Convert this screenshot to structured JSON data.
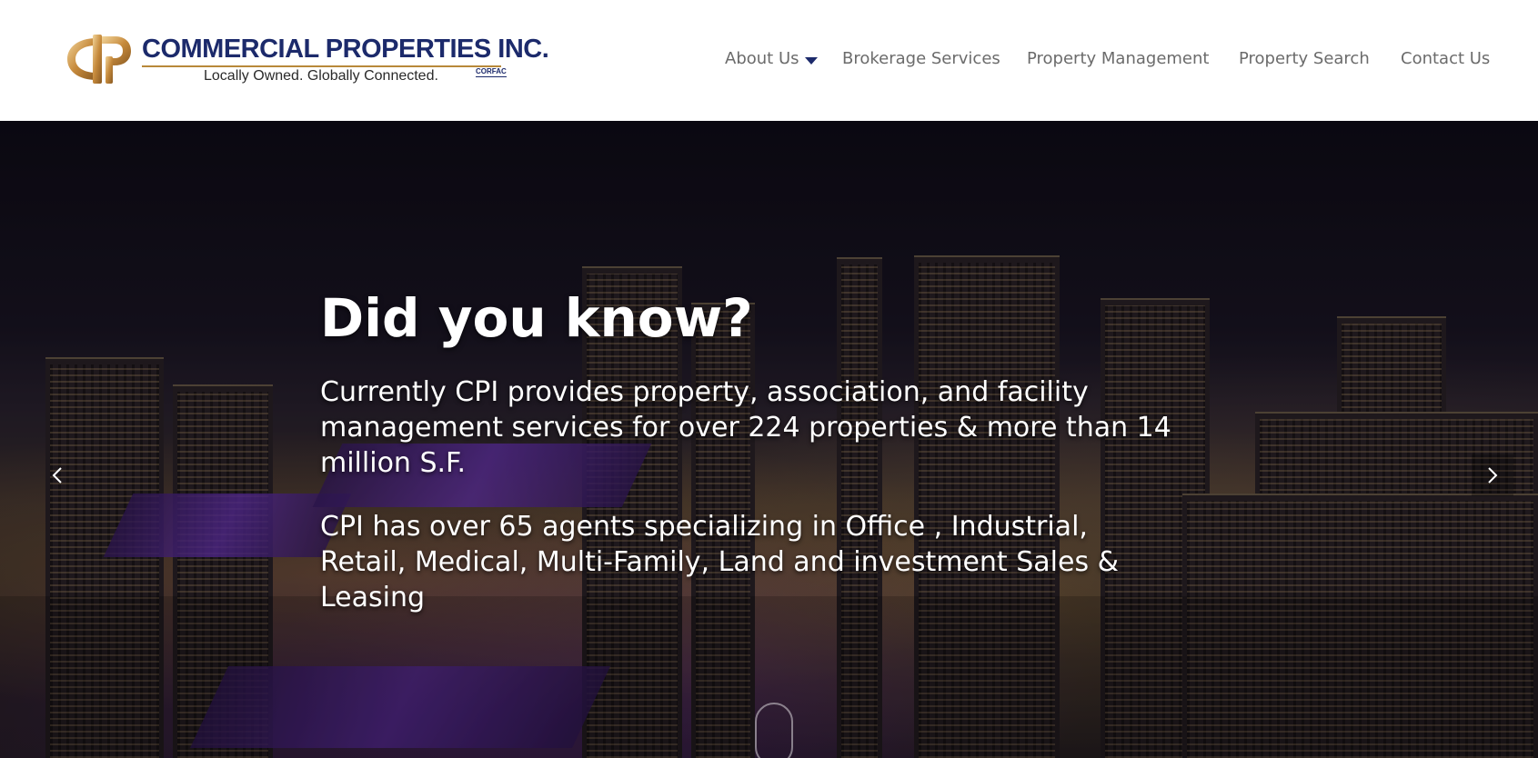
{
  "brand": {
    "name": "COMMERCIAL  PROPERTIES INC.",
    "tagline": "Locally Owned. Globally Connected.",
    "badge": "CORFAC",
    "colors": {
      "navy": "#1c2a6b",
      "gold": "#b8893a"
    }
  },
  "nav": {
    "items": [
      {
        "label": "About Us",
        "has_dropdown": true,
        "icon": "caret-down-icon"
      },
      {
        "label": "Brokerage Services"
      },
      {
        "label": "Property Management"
      },
      {
        "label": "Property Search"
      },
      {
        "label": "Contact Us"
      }
    ]
  },
  "hero": {
    "title": "Did you know?",
    "paragraphs": [
      "Currently CPI provides property, association, and facility management services for over 224 properties & more than 14 million S.F.",
      "CPI has over 65 agents specializing in Office , Industrial, Retail, Medical, Multi-Family, Land and investment Sales & Leasing"
    ],
    "prev_icon": "chevron-left-icon",
    "next_icon": "chevron-right-icon",
    "scroll_icon": "scroll-down-icon"
  }
}
